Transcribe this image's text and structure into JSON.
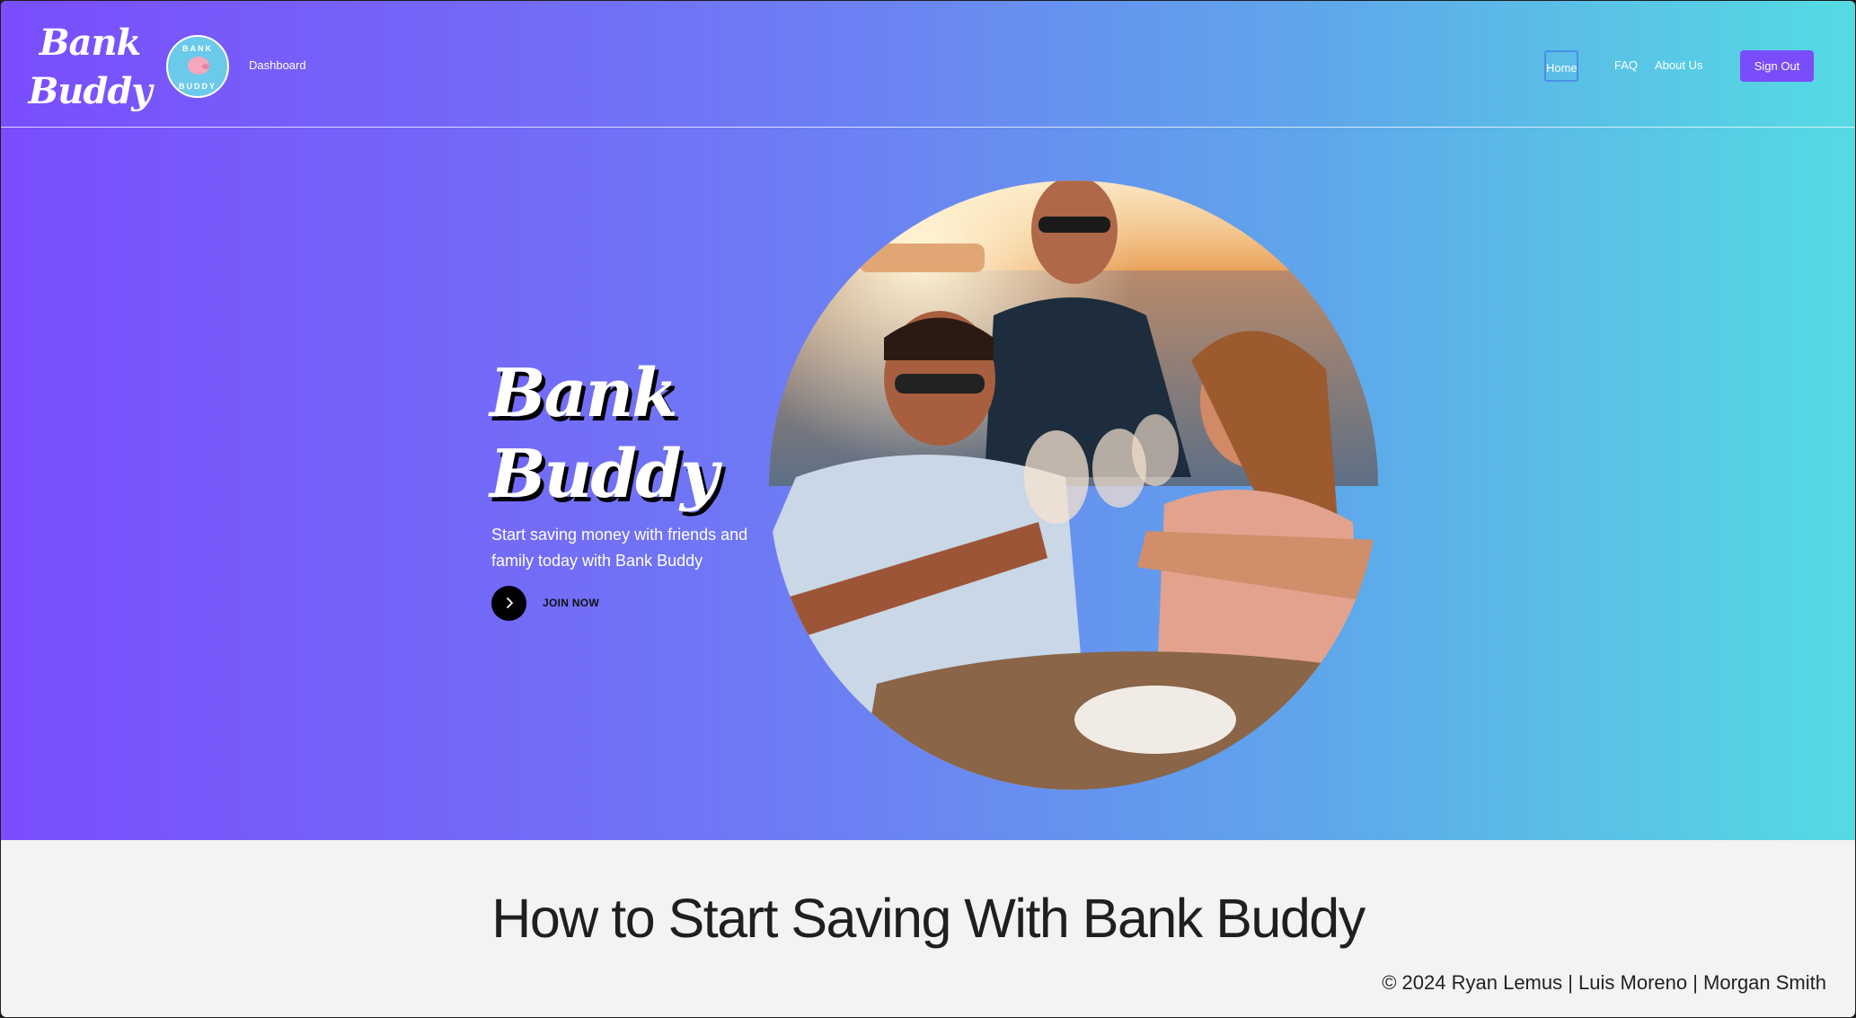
{
  "nav": {
    "brand_line1": "Bank",
    "brand_line2": "Buddy",
    "logo_ring_top": "BANK",
    "logo_ring_bottom": "BUDDY",
    "dashboard": "Dashboard",
    "home": "Home",
    "faq": "FAQ",
    "about": "About Us",
    "signout": "Sign Out"
  },
  "hero": {
    "title_line1": "Bank",
    "title_line2": "Buddy",
    "subtitle": "Start saving money with friends and family today with Bank Buddy",
    "cta_label": "JOIN NOW",
    "cta_icon": "chevron-right-icon"
  },
  "section": {
    "title": "How to Start Saving With Bank Buddy"
  },
  "footer": {
    "copyright": "© 2024 Ryan Lemus | Luis Moreno | Morgan Smith"
  },
  "colors": {
    "gradient_start": "#7b4dfd",
    "gradient_end": "#55dbe3",
    "signout_button": "#7a4dfa",
    "page_background": "#f3f3f3"
  }
}
